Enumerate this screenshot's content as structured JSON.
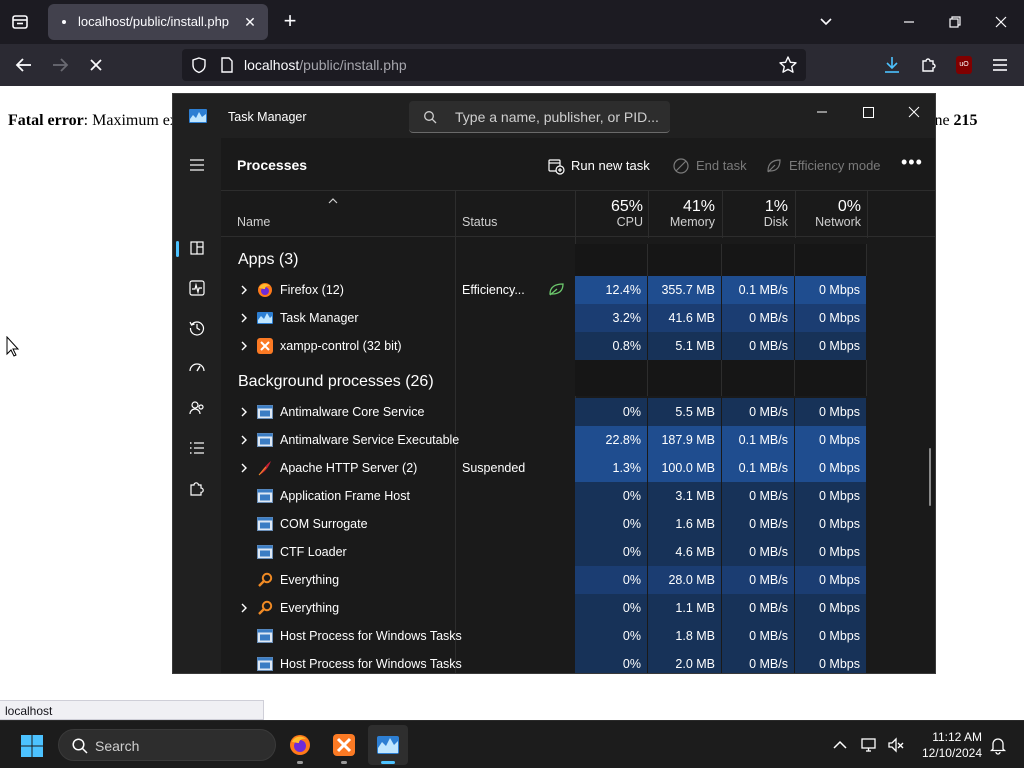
{
  "browser": {
    "tab_title": "localhost/public/install.php",
    "url_host": "localhost",
    "url_path": "/public/install.php",
    "ublock_badge": "uO"
  },
  "page": {
    "error_label": "Fatal error",
    "error_text": ": Maximum ex",
    "error_tail": "ine ",
    "error_line": "215",
    "status_text": "localhost"
  },
  "taskmanager": {
    "title": "Task Manager",
    "search_placeholder": "Type a name, publisher, or PID...",
    "section_title": "Processes",
    "commands": {
      "run_new_task": "Run new task",
      "end_task": "End task",
      "efficiency_mode": "Efficiency mode"
    },
    "columns": {
      "name": "Name",
      "status": "Status",
      "cpu_pct": "65%",
      "cpu": "CPU",
      "memory_pct": "41%",
      "memory": "Memory",
      "disk_pct": "1%",
      "disk": "Disk",
      "network_pct": "0%",
      "network": "Network"
    },
    "apps_group": "Apps (3)",
    "background_group": "Background processes (26)",
    "apps": [
      {
        "name": "Firefox (12)",
        "status": "Efficiency...",
        "cpu": "12.4%",
        "memory": "355.7 MB",
        "disk": "0.1 MB/s",
        "network": "0 Mbps",
        "icon": "firefox-icon"
      },
      {
        "name": "Task Manager",
        "status": "",
        "cpu": "3.2%",
        "memory": "41.6 MB",
        "disk": "0 MB/s",
        "network": "0 Mbps",
        "icon": "task-manager-icon"
      },
      {
        "name": "xampp-control (32 bit)",
        "status": "",
        "cpu": "0.8%",
        "memory": "5.1 MB",
        "disk": "0 MB/s",
        "network": "0 Mbps",
        "icon": "xampp-icon"
      }
    ],
    "background": [
      {
        "name": "Antimalware Core Service",
        "status": "",
        "cpu": "0%",
        "memory": "5.5 MB",
        "disk": "0 MB/s",
        "network": "0 Mbps",
        "icon": "service-icon"
      },
      {
        "name": "Antimalware Service Executable",
        "status": "",
        "cpu": "22.8%",
        "memory": "187.9 MB",
        "disk": "0.1 MB/s",
        "network": "0 Mbps",
        "icon": "service-icon"
      },
      {
        "name": "Apache HTTP Server (2)",
        "status": "Suspended",
        "cpu": "1.3%",
        "memory": "100.0 MB",
        "disk": "0.1 MB/s",
        "network": "0 Mbps",
        "icon": "apache-feather-icon"
      },
      {
        "name": "Application Frame Host",
        "status": "",
        "cpu": "0%",
        "memory": "3.1 MB",
        "disk": "0 MB/s",
        "network": "0 Mbps",
        "icon": "service-icon"
      },
      {
        "name": "COM Surrogate",
        "status": "",
        "cpu": "0%",
        "memory": "1.6 MB",
        "disk": "0 MB/s",
        "network": "0 Mbps",
        "icon": "service-icon"
      },
      {
        "name": "CTF Loader",
        "status": "",
        "cpu": "0%",
        "memory": "4.6 MB",
        "disk": "0 MB/s",
        "network": "0 Mbps",
        "icon": "service-icon"
      },
      {
        "name": "Everything",
        "status": "",
        "cpu": "0%",
        "memory": "28.0 MB",
        "disk": "0 MB/s",
        "network": "0 Mbps",
        "icon": "everything-search-icon"
      },
      {
        "name": "Everything",
        "status": "",
        "cpu": "0%",
        "memory": "1.1 MB",
        "disk": "0 MB/s",
        "network": "0 Mbps",
        "icon": "everything-search-icon"
      },
      {
        "name": "Host Process for Windows Tasks",
        "status": "",
        "cpu": "0%",
        "memory": "1.8 MB",
        "disk": "0 MB/s",
        "network": "0 Mbps",
        "icon": "service-icon"
      },
      {
        "name": "Host Process for Windows Tasks",
        "status": "",
        "cpu": "0%",
        "memory": "2.0 MB",
        "disk": "0 MB/s",
        "network": "0 Mbps",
        "icon": "service-icon"
      }
    ]
  },
  "taskbar": {
    "search_label": "Search",
    "time": "11:12 AM",
    "date": "12/10/2024"
  },
  "colors": {
    "heat_high": "#1f4d8f",
    "heat_mid": "#1b3d72",
    "heat_low": "#173258",
    "accent": "#4cc2ff"
  }
}
